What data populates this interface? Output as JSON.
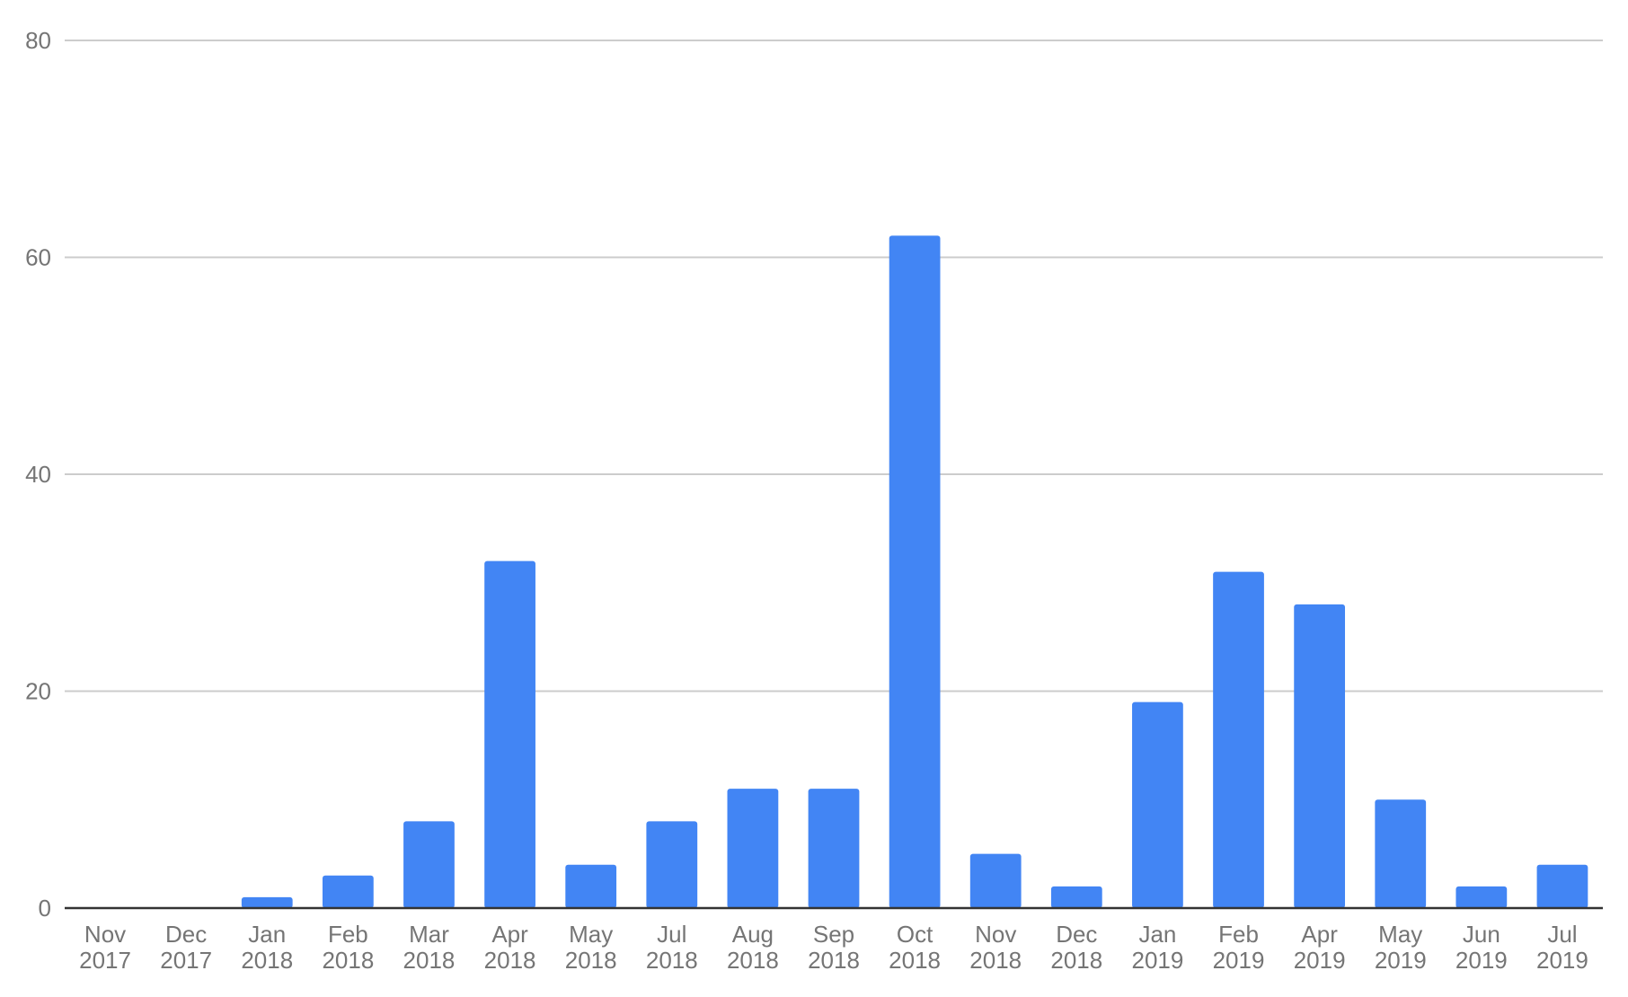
{
  "chart_data": {
    "type": "bar",
    "title": "",
    "xlabel": "",
    "ylabel": "",
    "categories": [
      [
        "Nov",
        "2017"
      ],
      [
        "Dec",
        "2017"
      ],
      [
        "Jan",
        "2018"
      ],
      [
        "Feb",
        "2018"
      ],
      [
        "Mar",
        "2018"
      ],
      [
        "Apr",
        "2018"
      ],
      [
        "May",
        "2018"
      ],
      [
        "Jul",
        "2018"
      ],
      [
        "Aug",
        "2018"
      ],
      [
        "Sep",
        "2018"
      ],
      [
        "Oct",
        "2018"
      ],
      [
        "Nov",
        "2018"
      ],
      [
        "Dec",
        "2018"
      ],
      [
        "Jan",
        "2019"
      ],
      [
        "Feb",
        "2019"
      ],
      [
        "Apr",
        "2019"
      ],
      [
        "May",
        "2019"
      ],
      [
        "Jun",
        "2019"
      ],
      [
        "Jul",
        "2019"
      ]
    ],
    "values": [
      0,
      0,
      1,
      3,
      8,
      32,
      4,
      8,
      11,
      11,
      62,
      5,
      2,
      19,
      31,
      28,
      10,
      2,
      4
    ],
    "ylim": [
      0,
      80
    ],
    "yticks": [
      0,
      20,
      40,
      60,
      80
    ],
    "grid": true,
    "legend": "none",
    "bar_color": "#4285f4",
    "gridline_color": "#cccccc",
    "axis_color": "#333333",
    "label_color": "#757575"
  }
}
